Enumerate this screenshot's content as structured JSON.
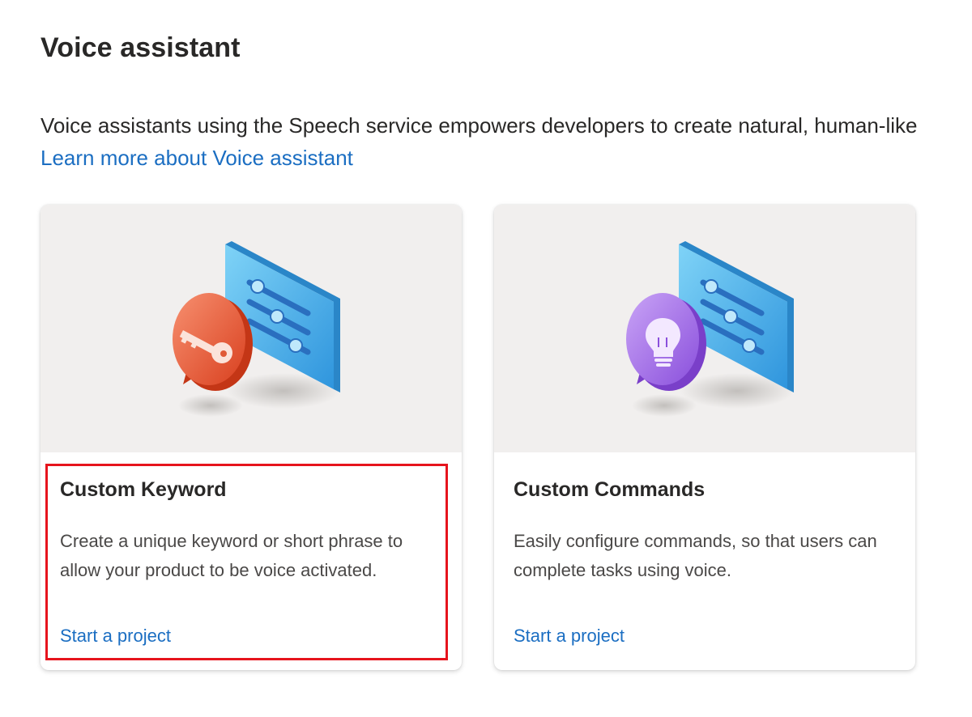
{
  "header": {
    "title": "Voice assistant",
    "description": "Voice assistants using the Speech service empowers developers to create natural, human-like",
    "learn_more_link": "Learn more about Voice assistant"
  },
  "cards": [
    {
      "title": "Custom Keyword",
      "description": "Create a unique keyword or short phrase to allow your product to be voice activated.",
      "link": "Start a project",
      "icon": "key-speech-bubble-icon",
      "bubble_color": "#e9573a"
    },
    {
      "title": "Custom Commands",
      "description": "Easily configure commands, so that users can complete tasks using voice.",
      "link": "Start a project",
      "icon": "lightbulb-speech-bubble-icon",
      "bubble_color": "#9b5de5"
    }
  ],
  "colors": {
    "link": "#1b6ec2",
    "highlight": "#e6141d",
    "hero_bg": "#f1efee",
    "panel_blue": "#3aa7e6"
  }
}
